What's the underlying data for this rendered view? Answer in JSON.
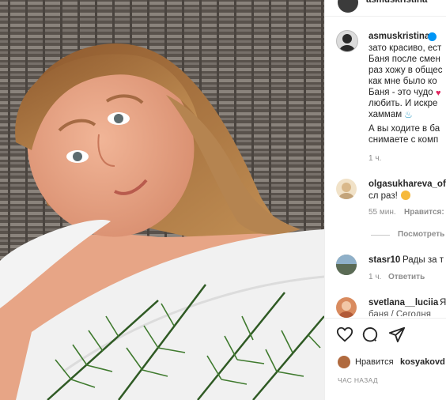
{
  "post": {
    "author": "asmuskristina",
    "caption_lines": [
      "зато красиво, ест",
      "Баня после смен",
      "раз хожу в общес",
      "как мне было ко",
      "Баня - это чудо",
      "любить. И искре",
      "хаммам",
      "А вы ходите в ба",
      "снимаете с комп"
    ],
    "caption_time": "1 ч.",
    "verified_color": "#0095f6"
  },
  "comments": [
    {
      "username": "olgasukhareva_of",
      "text": "сл раз!",
      "time": "55 мин.",
      "like_label": "Нравится:",
      "replies_label": "Посмотреть"
    },
    {
      "username": "stasr10",
      "text": "Рады за т",
      "time": "1 ч.",
      "reply_label": "Ответить"
    },
    {
      "username": "svetlana__luciia",
      "text": "Я",
      "text2": "баня / Сегодня"
    }
  ],
  "actions": {
    "like": "heart-icon",
    "comment": "comment-icon",
    "share": "share-icon"
  },
  "likes": {
    "prefix": "Нравится",
    "user": "kosyakovd"
  },
  "posted": "ЧАС НАЗАД"
}
